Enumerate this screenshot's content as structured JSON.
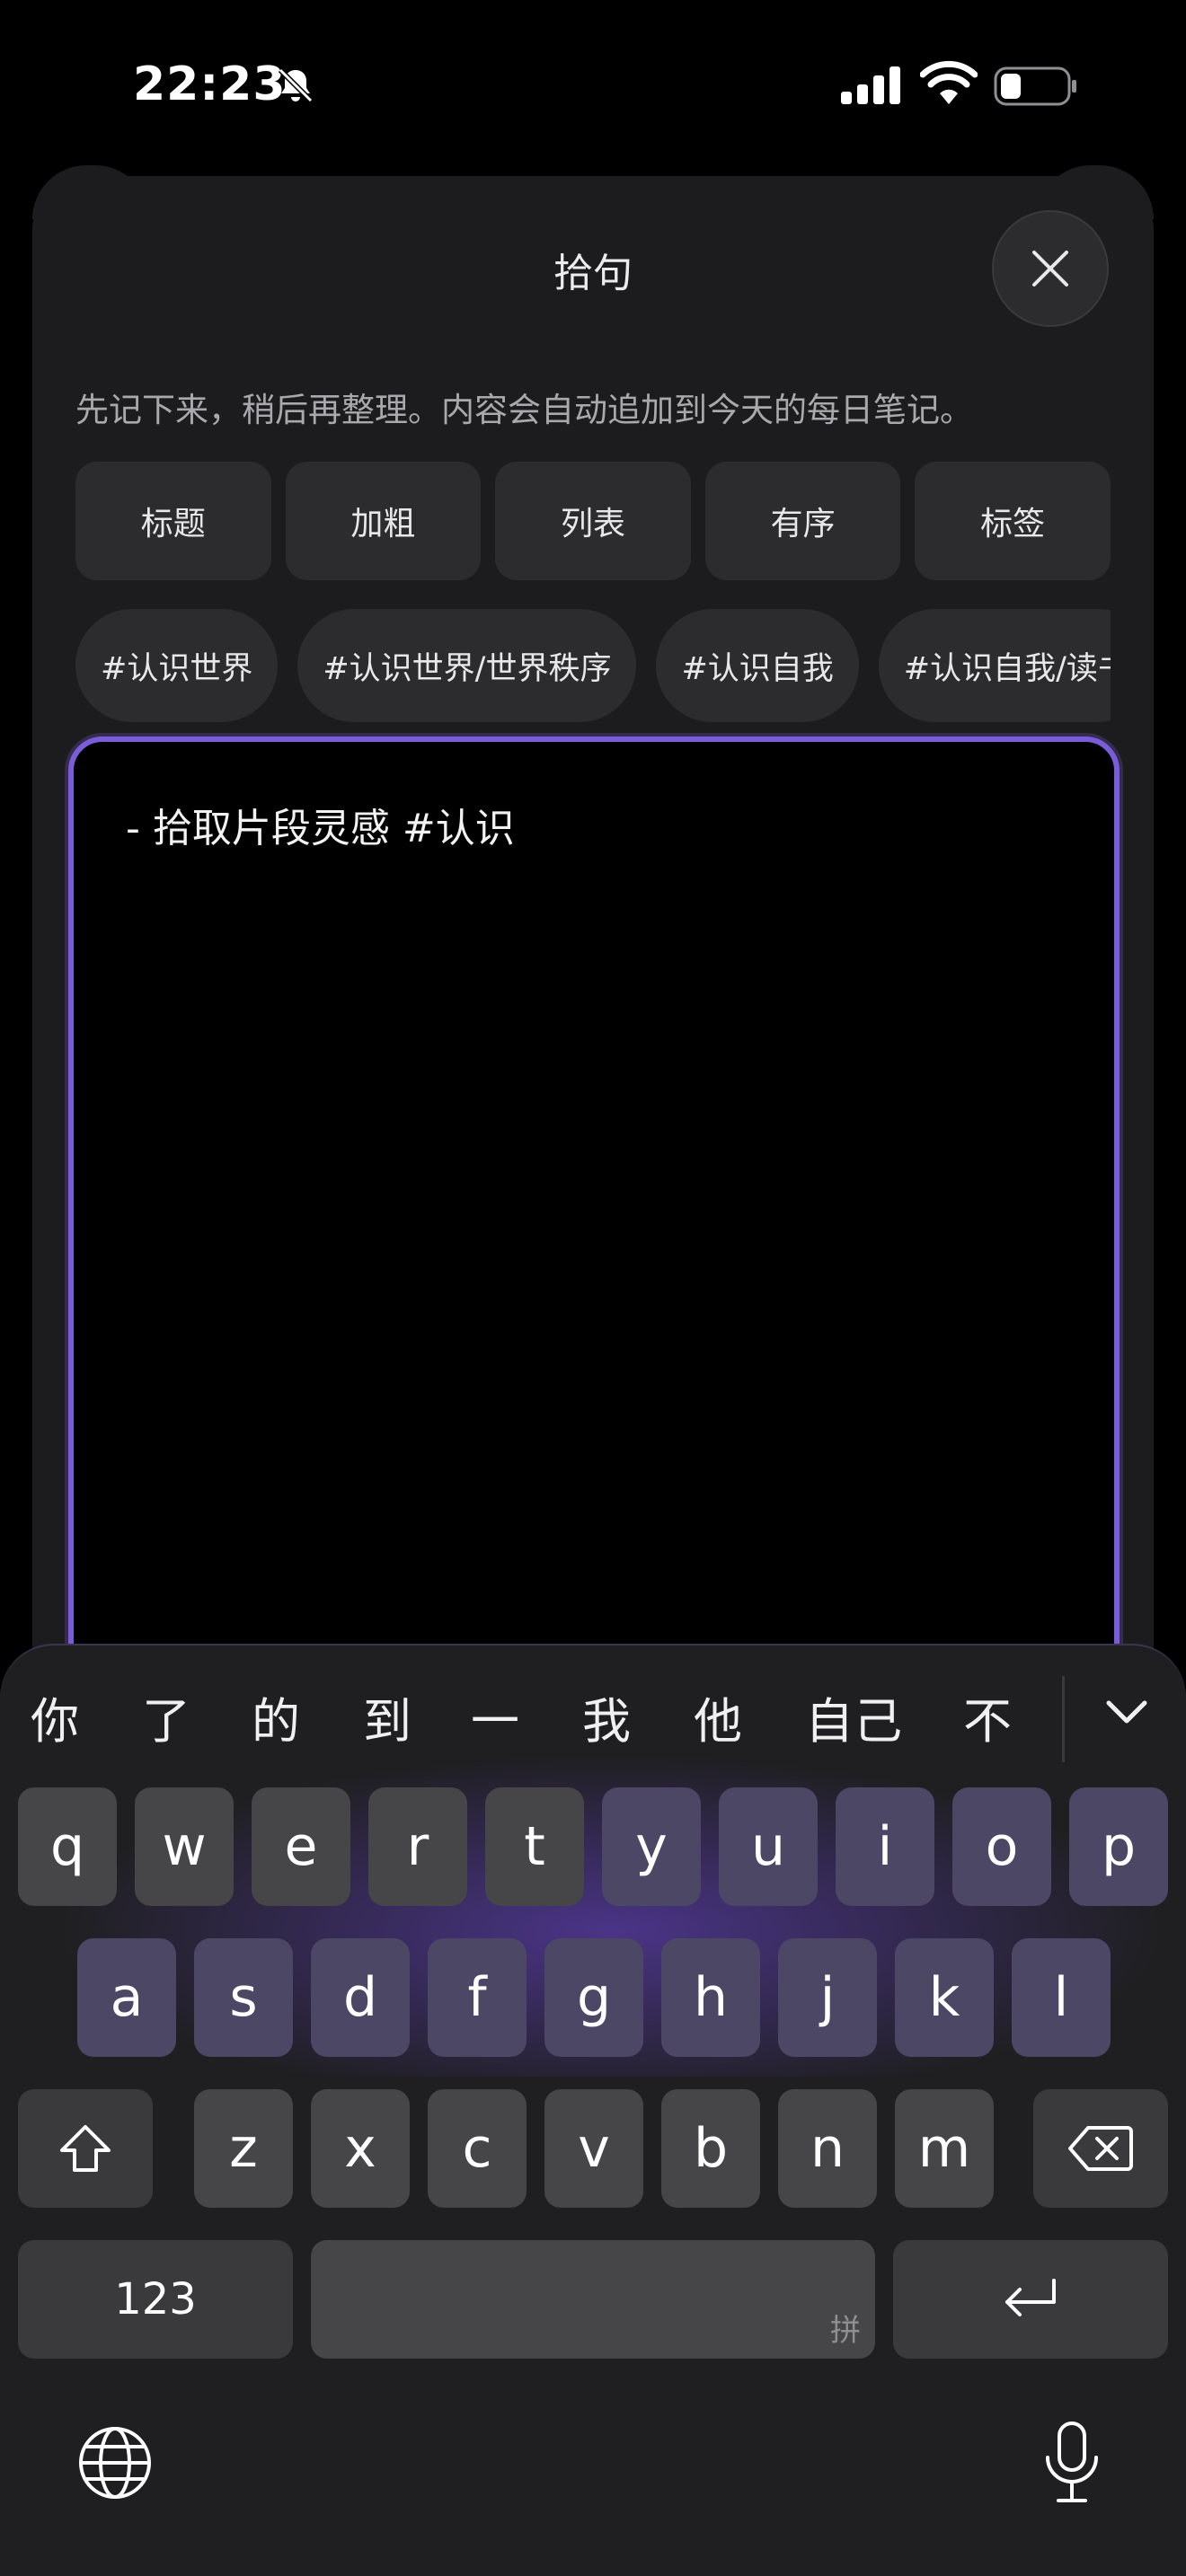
{
  "status": {
    "time": "22:23"
  },
  "sheet": {
    "title": "拾句",
    "hint": "先记下来，稍后再整理。内容会自动追加到今天的每日笔记。",
    "format_buttons": [
      "标题",
      "加粗",
      "列表",
      "有序",
      "标签"
    ],
    "tags": [
      "#认识世界",
      "#认识世界/世界秩序",
      "#认识自我",
      "#认识自我/读书"
    ],
    "editor_text": "- 拾取片段灵感 #认识"
  },
  "keyboard": {
    "candidates": [
      "你",
      "了",
      "的",
      "到",
      "一",
      "我",
      "他",
      "自己",
      "不"
    ],
    "row1": [
      "q",
      "w",
      "e",
      "r",
      "t",
      "y",
      "u",
      "i",
      "o",
      "p"
    ],
    "row2": [
      "a",
      "s",
      "d",
      "f",
      "g",
      "h",
      "j",
      "k",
      "l"
    ],
    "row3": [
      "z",
      "x",
      "c",
      "v",
      "b",
      "n",
      "m"
    ],
    "numbers_label": "123",
    "space_sub_label": "拼"
  },
  "icons": {
    "bell": "bell-slash-icon",
    "signal": "cellular-signal-icon",
    "wifi": "wifi-icon",
    "battery": "battery-icon",
    "close": "close-icon",
    "collapse": "chevron-down-icon",
    "shift": "shift-icon",
    "delete": "backspace-icon",
    "return": "return-icon",
    "globe": "globe-icon",
    "mic": "microphone-icon"
  },
  "colors": {
    "accent": "#7a5cd8",
    "sheet": "#1c1c1e",
    "key": "#464649"
  }
}
